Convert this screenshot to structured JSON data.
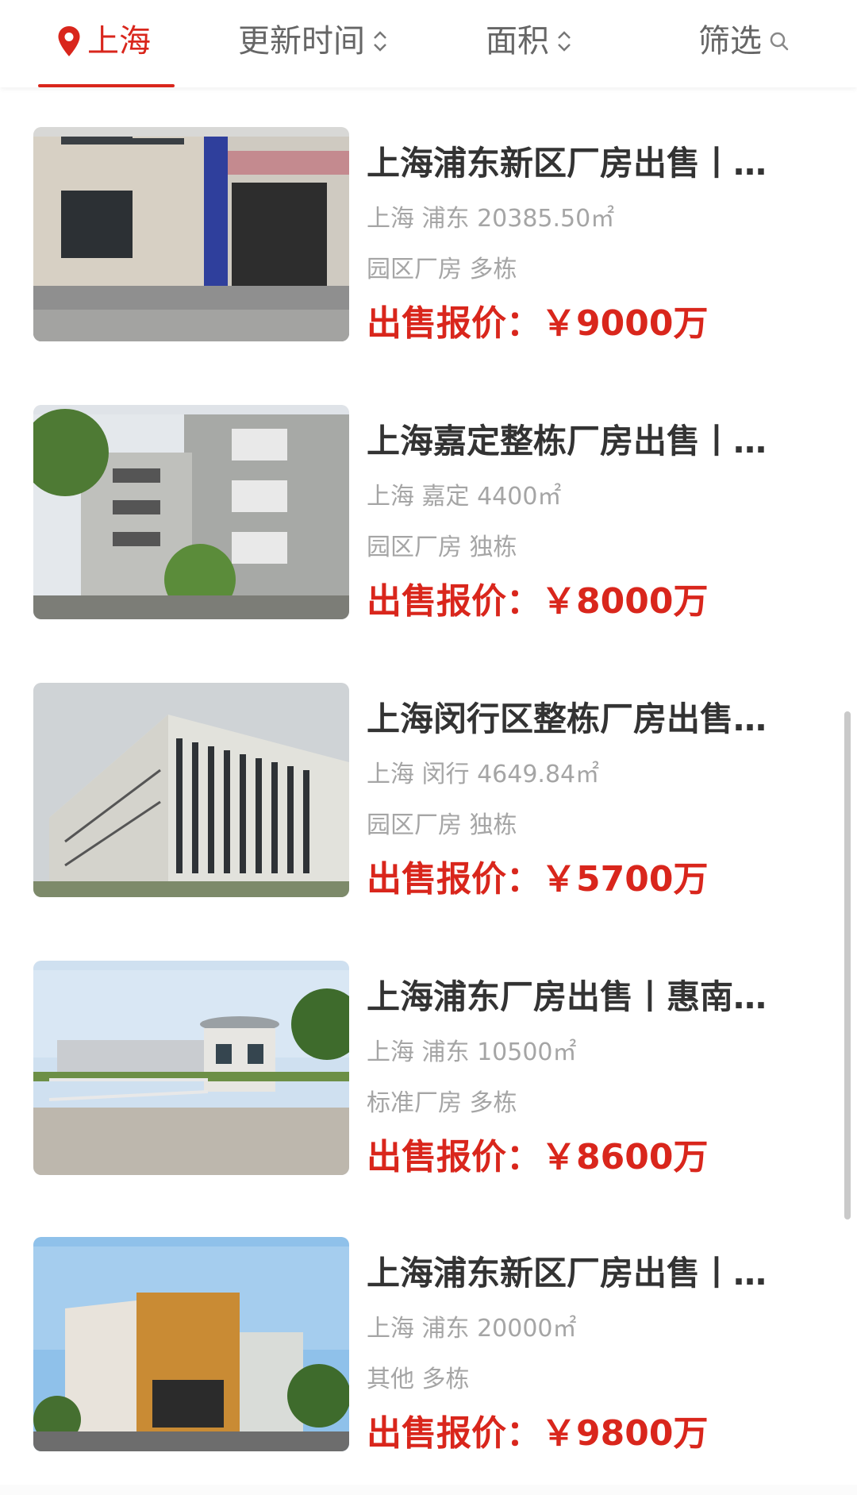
{
  "header": {
    "tabs": [
      {
        "label": "上海",
        "icon": "location-pin-icon",
        "active": true
      },
      {
        "label": "更新时间",
        "icon": "sort-arrows-icon"
      },
      {
        "label": "面积",
        "icon": "sort-arrows-icon"
      },
      {
        "label": "筛选",
        "icon": "search-icon"
      }
    ],
    "accent_color": "#d9261c"
  },
  "listings": [
    {
      "title": "上海浦东新区厂房出售丨…",
      "meta": "上海 浦东 20385.50㎡",
      "tags": "园区厂房 多栋",
      "price": "出售报价：￥9000万"
    },
    {
      "title": "上海嘉定整栋厂房出售丨…",
      "meta": "上海 嘉定 4400㎡",
      "tags": "园区厂房 独栋",
      "price": "出售报价：￥8000万"
    },
    {
      "title": "上海闵行区整栋厂房出售…",
      "meta": "上海 闵行 4649.84㎡",
      "tags": "园区厂房 独栋",
      "price": "出售报价：￥5700万"
    },
    {
      "title": "上海浦东厂房出售丨惠南…",
      "meta": "上海 浦东 10500㎡",
      "tags": "标准厂房 多栋",
      "price": "出售报价：￥8600万"
    },
    {
      "title": "上海浦东新区厂房出售丨…",
      "meta": "上海 浦东 20000㎡",
      "tags": "其他 多栋",
      "price": "出售报价：￥9800万"
    }
  ]
}
